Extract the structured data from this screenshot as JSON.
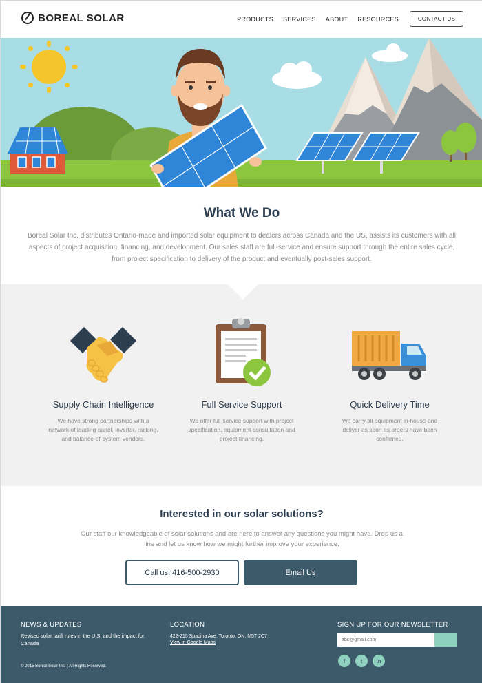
{
  "brand": {
    "name": "BOREAL SOLAR"
  },
  "nav": {
    "items": [
      "PRODUCTS",
      "SERVICES",
      "ABOUT",
      "RESOURCES"
    ],
    "contact_label": "CONTACT US"
  },
  "what_we_do": {
    "title": "What We Do",
    "text": "Boreal Solar Inc. distributes Ontario-made and imported solar equipment to dealers across Canada and the US, assists its customers with all aspects of project acquisition, financing, and development. Our sales staff are full-service and ensure support through the entire sales cycle, from project specification to delivery of the product and eventually post-sales support."
  },
  "features": [
    {
      "title": "Supply Chain Intelligence",
      "text": "We have strong partnerships with a network of leading panel, inverter, racking, and balance-of-system vendors.",
      "icon": "handshake-icon"
    },
    {
      "title": "Full Service Support",
      "text": "We offer full-service support with project specification, equipment consultation and project financing.",
      "icon": "clipboard-check-icon"
    },
    {
      "title": "Quick Delivery Time",
      "text": "We carry all equipment in-house and deliver as soon as orders have been confirmed.",
      "icon": "truck-icon"
    }
  ],
  "cta": {
    "title": "Interested in our solar solutions?",
    "text": "Our staff our knowledgeable of solar solutions and are here to answer any questions you might have. Drop us a line and let us know how we might further improve your experience.",
    "call_label": "Call us:  416-500-2930",
    "email_label": "Email Us"
  },
  "footer": {
    "news_title": "NEWS & UPDATES",
    "news_text": "Revised solar tariff rules in the U.S. and the impact for Canada",
    "location_title": "LOCATION",
    "address": "422-215 Spadina Ave, Toronto, ON, M5T 2C7",
    "maps_link": "View in Google Maps",
    "newsletter_title": "SIGN UP FOR OUR NEWSLETTER",
    "newsletter_placeholder": "abc@gmail.com",
    "copyright": "© 2015 Boreal Solar Inc. | All Rights Reserved.",
    "social": [
      "f",
      "t",
      "in"
    ]
  },
  "colors": {
    "primary": "#3d5a6b",
    "accent": "#8fd1bf",
    "sky": "#a8dde5",
    "grass": "#8cc63f"
  }
}
